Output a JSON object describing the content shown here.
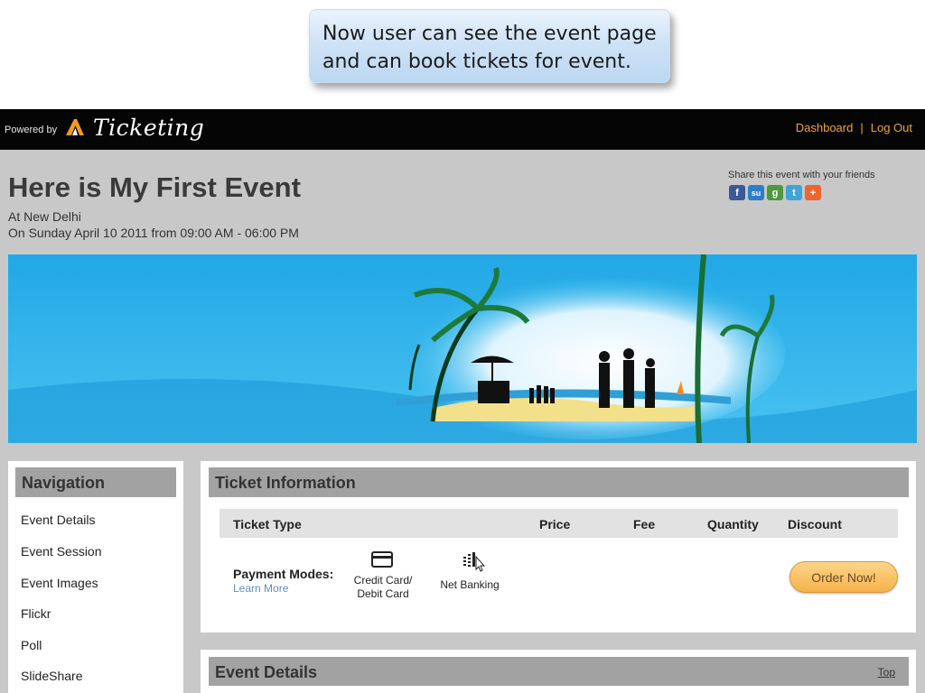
{
  "callout": {
    "line1": "Now user can see the event page",
    "line2": "and can book tickets for event."
  },
  "header": {
    "powered_by": "Powered by",
    "brand": "Ticketing",
    "links": {
      "dashboard": "Dashboard",
      "separator": "|",
      "logout": "Log Out"
    }
  },
  "event": {
    "title": "Here is My First Event",
    "location": "At New Delhi",
    "datetime": "On Sunday April 10 2011 from 09:00 AM - 06:00 PM"
  },
  "share": {
    "text": "Share this event with your friends",
    "icons": [
      {
        "name": "facebook-icon",
        "glyph": "f",
        "color": "#3b5998"
      },
      {
        "name": "stumbleupon-icon",
        "glyph": "su",
        "color": "#2a7fc8"
      },
      {
        "name": "google-icon",
        "glyph": "g",
        "color": "#4c9a3c"
      },
      {
        "name": "twitter-icon",
        "glyph": "t",
        "color": "#3fa4d8"
      },
      {
        "name": "addthis-icon",
        "glyph": "+",
        "color": "#f0642e"
      }
    ]
  },
  "navigation": {
    "title": "Navigation",
    "items": [
      "Event Details",
      "Event Session",
      "Event Images",
      "Flickr",
      "Poll",
      "SlideShare"
    ]
  },
  "ticket_info": {
    "title": "Ticket Information",
    "columns": [
      "Ticket Type",
      "Price",
      "Fee",
      "Quantity",
      "Discount"
    ],
    "payment_label": "Payment Modes:",
    "learn_more": "Learn More",
    "modes": {
      "card_line1": "Credit Card/",
      "card_line2": "Debit Card",
      "netbanking": "Net Banking"
    },
    "order_button": "Order Now!"
  },
  "event_details": {
    "title": "Event Details",
    "top_link": "Top"
  },
  "colors": {
    "accent_orange": "#f0a43b",
    "panel_gray": "#a2a2a2",
    "sky_blue": "#2fb2ea"
  }
}
